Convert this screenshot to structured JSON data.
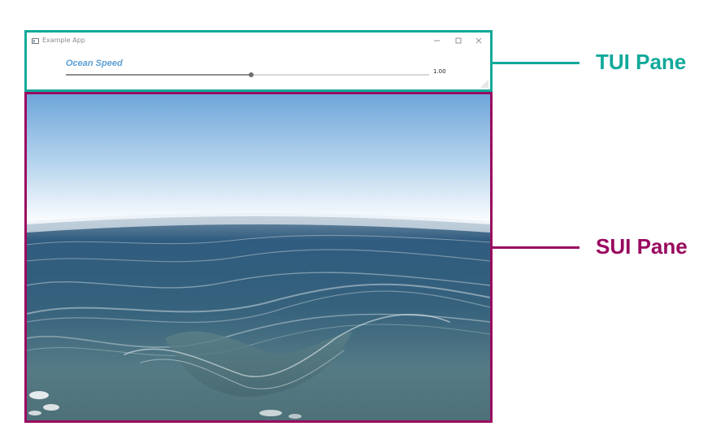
{
  "window": {
    "title": "Example App",
    "icon": "app-window-icon",
    "controls": [
      "minimize-icon",
      "maximize-icon",
      "close-icon"
    ]
  },
  "slider": {
    "label": "Ocean Speed",
    "value_text": "1.00",
    "fill_fraction": 0.51
  },
  "callouts": {
    "tui_label": "TUI Pane",
    "sui_label": "SUI Pane",
    "tui_color": "#12a99a",
    "sui_color": "#990a5f"
  }
}
